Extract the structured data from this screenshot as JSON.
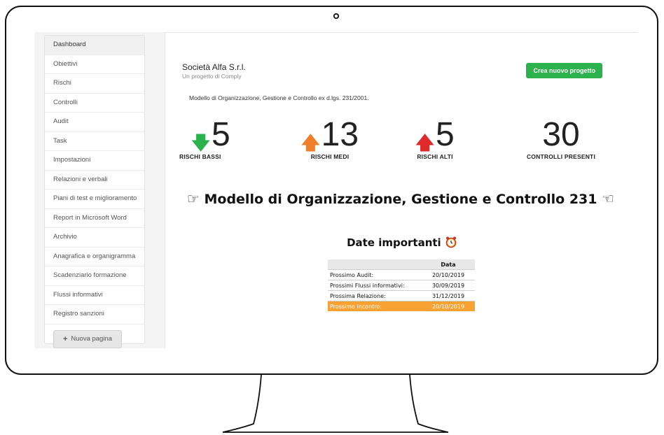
{
  "sidebar": {
    "items": [
      {
        "label": "Dashboard",
        "active": true
      },
      {
        "label": "Obiettivi"
      },
      {
        "label": "Rischi"
      },
      {
        "label": "Controlli"
      },
      {
        "label": "Audit"
      },
      {
        "label": "Task"
      },
      {
        "label": "Impostazioni"
      },
      {
        "label": "Relazioni e verbali"
      },
      {
        "label": "Piani di test e miglioramento"
      },
      {
        "label": "Report in Microsoft Word"
      },
      {
        "label": "Archivio"
      },
      {
        "label": "Anagrafica e organigramma"
      },
      {
        "label": "Scadenziario formazione"
      },
      {
        "label": "Flussi informativi"
      },
      {
        "label": "Registro sanzioni"
      }
    ],
    "new_page_label": "Nuova pagina",
    "new_page_icon": "plus-icon"
  },
  "header": {
    "company": "Società Alfa S.r.l.",
    "subtitle": "Un progetto di Comply",
    "new_project_label": "Crea nuovo progetto",
    "description": "Modello di Organizzazione, Gestione e Controllo ex d.lgs. 231/2001."
  },
  "stats": {
    "low": {
      "value": "5",
      "label": "RISCHI BASSI",
      "color": "#2bb24c",
      "icon": "arrow-down-icon"
    },
    "mid": {
      "value": "13",
      "label": "RISCHI MEDI",
      "color": "#f07f2a",
      "icon": "arrow-up-icon"
    },
    "high": {
      "value": "5",
      "label": "RISCHI ALTI",
      "color": "#e02a2a",
      "icon": "arrow-up-icon"
    },
    "controls": {
      "value": "30",
      "label": "CONTROLLI PRESENTI"
    }
  },
  "model": {
    "title": "Modello di Organizzazione, Gestione e Controllo 231"
  },
  "dates": {
    "title": "Date importanti",
    "header": "Data",
    "rows": [
      {
        "label": "Prossimo Audit:",
        "date": "20/10/2019"
      },
      {
        "label": "Prossimi Flussi informativi:",
        "date": "30/09/2019"
      },
      {
        "label": "Prossima Relazione:",
        "date": "31/12/2019"
      },
      {
        "label": "Prossimo incontro:",
        "date": "20/10/2019",
        "highlight": true
      }
    ]
  },
  "colors": {
    "accent_green": "#2bb24c",
    "highlight_orange": "#f7a233"
  }
}
